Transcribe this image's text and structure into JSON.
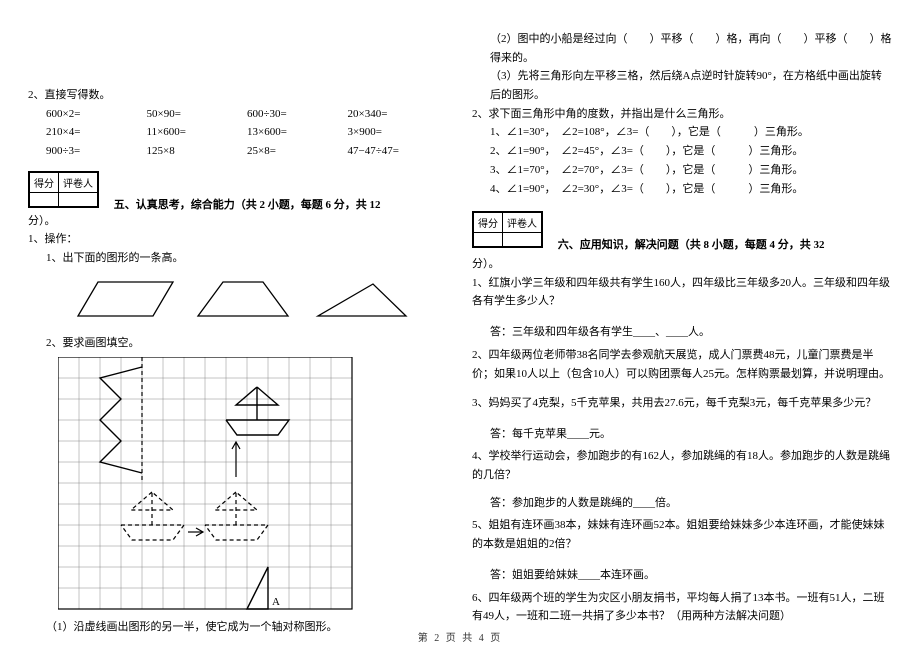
{
  "left": {
    "t2": "2、直接写得数。",
    "calc": [
      [
        "600×2=",
        "50×90=",
        "600÷30=",
        "20×340="
      ],
      [
        "210×4=",
        "11×600=",
        "13×600=",
        "3×900="
      ],
      [
        "900÷3=",
        "125×8",
        "25×8=",
        "47−47÷47="
      ]
    ],
    "grader1": "得分",
    "grader2": "评卷人",
    "sec5": "五、认真思考，综合能力（共 2 小题，每题 6 分，共 12",
    "fen": "分）。",
    "q1": "1、操作：",
    "q1a": "1、出下面的图形的一条高。",
    "q1b": "2、要求画图填空。",
    "q1c": "（1）沿虚线画出图形的另一半，使它成为一个轴对称图形。"
  },
  "right": {
    "r2": "（2）图中的小船是经过向（　　）平移（　　）格，再向（　　）平移（　　）格得来的。",
    "r3": "（3）先将三角形向左平移三格，然后绕A点逆时针旋转90°，在方格纸中画出旋转后的图形。",
    "t2": "2、求下面三角形中角的度数，并指出是什么三角形。",
    "rows": [
      "1、∠1=30°，　∠2=108°，∠3=（　　），它是（　　　）三角形。",
      "2、∠1=90°，　∠2=45°，∠3=（　　），它是（　　　）三角形。",
      "3、∠1=70°，　∠2=70°，∠3=（　　），它是（　　　）三角形。",
      "4、∠1=90°，　∠2=30°，∠3=（　　），它是（　　　）三角形。"
    ],
    "grader1": "得分",
    "grader2": "评卷人",
    "sec6": "六、应用知识，解决问题（共 8 小题，每题 4 分，共 32",
    "fen": "分）。",
    "q1": "1、红旗小学三年级和四年级共有学生160人，四年级比三年级多20人。三年级和四年级各有学生多少人？",
    "a1": "答：三年级和四年级各有学生____、____人。",
    "q2": "2、四年级两位老师带38名同学去参观航天展览，成人门票费48元，儿童门票费是半价；如果10人以上（包含10人）可以购团票每人25元。怎样购票最划算，并说明理由。",
    "q3": "3、妈妈买了4克梨，5千克苹果，共用去27.6元，每千克梨3元，每千克苹果多少元？",
    "a3": "答：每千克苹果____元。",
    "q4": "4、学校举行运动会，参加跑步的有162人，参加跳绳的有18人。参加跑步的人数是跳绳的几倍？",
    "a4": "答：参加跑步的人数是跳绳的____倍。",
    "q5": "5、姐姐有连环画38本，妹妹有连环画52本。姐姐要给妹妹多少本连环画，才能使妹妹的本数是姐姐的2倍？",
    "a5": "答：姐姐要给妹妹____本连环画。",
    "q6": "6、四年级两个班的学生为灾区小朋友捐书，平均每人捐了13本书。一班有51人，二班有49人，一班和二班一共捐了多少本书？（用两种方法解决问题）"
  },
  "footer": "第 2 页 共 4 页"
}
